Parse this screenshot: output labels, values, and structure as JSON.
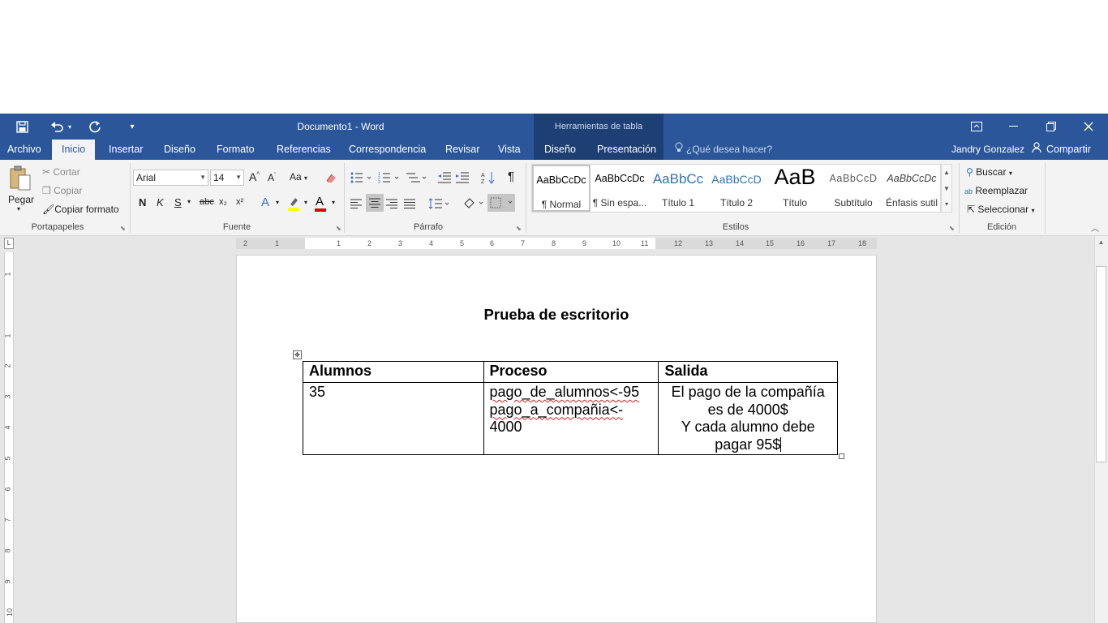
{
  "window": {
    "title": "Documento1 - Word",
    "contextual_title": "Herramientas de tabla"
  },
  "quick_access": {
    "save_icon": "save-icon",
    "undo_icon": "undo-icon",
    "redo_icon": "redo-icon",
    "customize_icon": "customize-icon"
  },
  "tabs": [
    {
      "label": "Archivo"
    },
    {
      "label": "Inicio"
    },
    {
      "label": "Insertar"
    },
    {
      "label": "Diseño"
    },
    {
      "label": "Formato"
    },
    {
      "label": "Referencias"
    },
    {
      "label": "Correspondencia"
    },
    {
      "label": "Revisar"
    },
    {
      "label": "Vista"
    },
    {
      "label": "Diseño"
    },
    {
      "label": "Presentación"
    }
  ],
  "tellme": {
    "placeholder": "¿Qué desea hacer?"
  },
  "user": {
    "name": "Jandry Gonzalez",
    "share_label": "Compartir"
  },
  "ribbon": {
    "clipboard": {
      "paste": "Pegar",
      "cut": "Cortar",
      "copy": "Copiar",
      "format_painter": "Copiar formato",
      "label": "Portapapeles"
    },
    "font": {
      "family": "Arial",
      "size": "14",
      "label": "Fuente",
      "case_label": "Aa",
      "bold": "N",
      "italic": "K",
      "underline": "S",
      "strike": "abc",
      "subscript": "x₂",
      "superscript": "x²",
      "color_letter": "A"
    },
    "paragraph": {
      "label": "Párrafo"
    },
    "styles": {
      "label": "Estilos",
      "items": [
        {
          "preview": "AaBbCcDc",
          "name": "¶ Normal"
        },
        {
          "preview": "AaBbCcDc",
          "name": "¶ Sin espa..."
        },
        {
          "preview": "AaBbCc",
          "name": "Título 1"
        },
        {
          "preview": "AaBbCcD",
          "name": "Título 2"
        },
        {
          "preview": "AaB",
          "name": "Título"
        },
        {
          "preview": "AaBbCcD",
          "name": "Subtítulo"
        },
        {
          "preview": "AaBbCcDc",
          "name": "Énfasis sutil"
        }
      ]
    },
    "editing": {
      "label": "Edición",
      "find": "Buscar",
      "replace": "Reemplazar",
      "select": "Seleccionar"
    }
  },
  "ruler": {
    "h_numbers": [
      "2",
      "1",
      "1",
      "2",
      "3",
      "4",
      "5",
      "6",
      "7",
      "8",
      "9",
      "10",
      "11",
      "12",
      "13",
      "14",
      "15",
      "16",
      "17",
      "18"
    ],
    "v_numbers": [
      "1",
      "1",
      "2",
      "3",
      "4",
      "5",
      "6",
      "7",
      "8",
      "9",
      "10"
    ]
  },
  "document": {
    "heading": "Prueba de escritorio",
    "table": {
      "headers": [
        "Alumnos",
        "Proceso",
        "Salida"
      ],
      "row": {
        "alumnos": "35",
        "proceso_line1": "pago_de_alumnos<-95",
        "proceso_line2": "pago_a_compañia<-",
        "proceso_line3": "4000",
        "salida_line1": "El pago de la compañía",
        "salida_line2": "es de 4000$",
        "salida_line3": "Y cada alumno debe",
        "salida_line4": "pagar 95$"
      }
    }
  }
}
